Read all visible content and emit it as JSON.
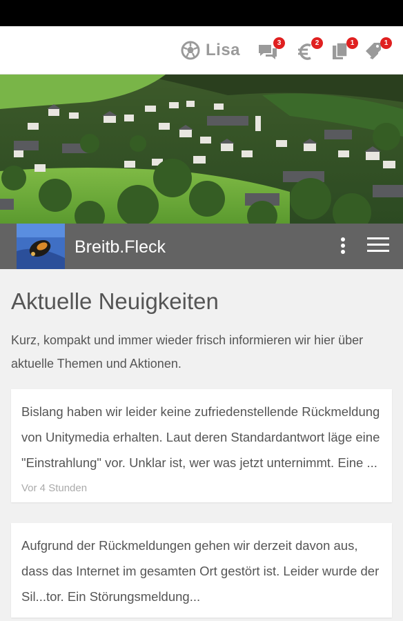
{
  "header": {
    "user_name": "Lisa",
    "user_icon": "soccer-ball-icon",
    "notifications": [
      {
        "icon": "chat-bubbles-icon",
        "count": "3"
      },
      {
        "icon": "euro-icon",
        "count": "2"
      },
      {
        "icon": "documents-icon",
        "count": "1"
      },
      {
        "icon": "tags-icon",
        "count": "1"
      }
    ]
  },
  "profile": {
    "name": "Breitb.Fleck"
  },
  "main": {
    "heading": "Aktuelle Neuigkeiten",
    "intro": "Kurz, kompakt und immer wieder frisch informieren wir hier über aktuelle Themen und Aktionen.",
    "posts": [
      {
        "text": "Bislang haben wir leider keine zufriedenstellende Rückmeldung von Unitymedia erhalten. Laut deren Standardantwort läge eine \"Einstrahlung\" vor. Unklar ist, wer was jetzt unternimmt. Eine ...",
        "time": "Vor 4 Stunden"
      },
      {
        "text": "Aufgrund der Rückmeldungen gehen wir derzeit davon aus, dass das Internet im gesamten Ort gestört ist. Leider wurde der Sil...tor. Ein Störungsmeldung...",
        "time": ""
      }
    ]
  },
  "colors": {
    "badge": "#e02020",
    "profile_bar": "#636363",
    "header_icon": "#9a9a9a",
    "text": "#555555"
  }
}
